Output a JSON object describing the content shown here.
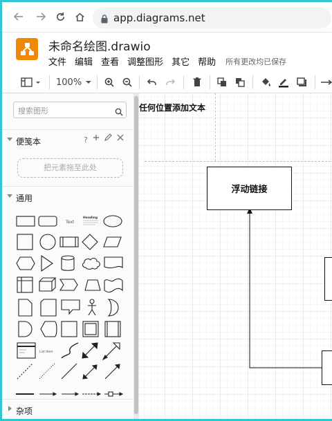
{
  "browser": {
    "url": "app.diagrams.net",
    "icons": [
      "arrow-left-icon",
      "arrow-right-icon",
      "reload-icon",
      "home-icon",
      "lock-icon"
    ]
  },
  "app": {
    "title": "未命名绘图.drawio",
    "menu": [
      "文件",
      "编辑",
      "查看",
      "调整图形",
      "其它",
      "帮助"
    ],
    "save_status": "所有更改均已保存",
    "accent": "#f08705"
  },
  "toolbar": {
    "zoom": "100%",
    "icons": [
      "page-view-icon",
      "zoom-in-icon",
      "zoom-out-icon",
      "undo-icon",
      "redo-icon",
      "delete-icon",
      "to-front-icon",
      "to-back-icon",
      "fill-color-icon",
      "line-color-icon",
      "shadow-icon",
      "connection-arrow-icon"
    ]
  },
  "sidebar": {
    "search_placeholder": "搜索图形",
    "scratchpad": {
      "label": "便笺本",
      "help": "?",
      "dropzone": "把元素拖至此处"
    },
    "general": {
      "label": "通用"
    },
    "shape_texts": {
      "text": "Text",
      "heading": "Heading",
      "list_item": "List Item"
    },
    "misc": {
      "label": "杂项"
    }
  },
  "canvas": {
    "hint": "任何位置添加文本",
    "floating_link": "浮动链接"
  }
}
